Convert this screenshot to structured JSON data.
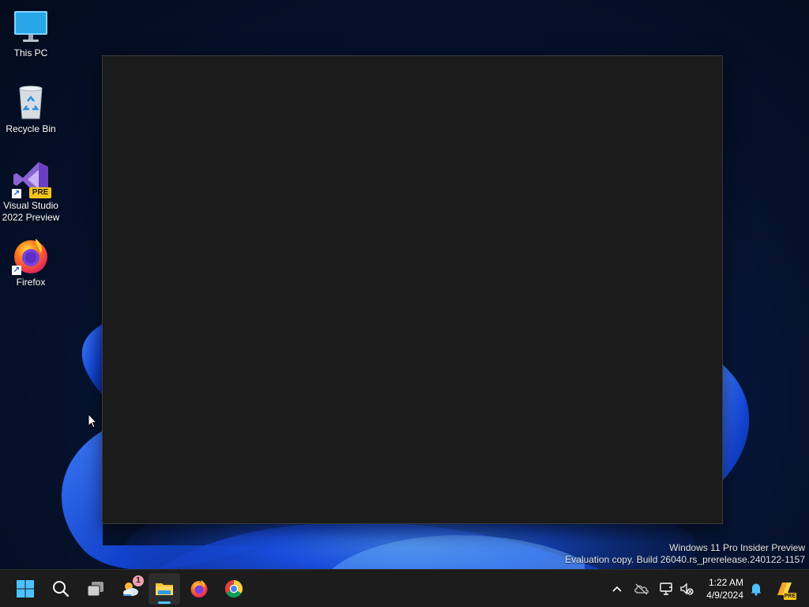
{
  "desktop": {
    "icons": [
      {
        "label": "This PC",
        "icon": "monitor-icon",
        "shortcut": false
      },
      {
        "label": "Recycle Bin",
        "icon": "recycle-bin-icon",
        "shortcut": false
      },
      {
        "label": "Visual Studio\n2022 Preview",
        "icon": "visual-studio-icon",
        "shortcut": true,
        "badge": "PRE"
      },
      {
        "label": "Firefox",
        "icon": "firefox-icon",
        "shortcut": true
      }
    ],
    "watermark": {
      "line1": "Windows 11 Pro Insider Preview",
      "line2": "Evaluation copy. Build 26040.rs_prerelease.240122-1157"
    }
  },
  "taskbar": {
    "buttons": [
      {
        "name": "start-button",
        "icon": "windows-logo-icon"
      },
      {
        "name": "search-button",
        "icon": "search-icon"
      },
      {
        "name": "task-view-button",
        "icon": "task-view-icon"
      },
      {
        "name": "widgets-button",
        "icon": "weather-icon",
        "badge": "1"
      },
      {
        "name": "file-explorer-button",
        "icon": "folder-icon",
        "active": true
      },
      {
        "name": "firefox-button",
        "icon": "firefox-icon"
      },
      {
        "name": "chrome-button",
        "icon": "chrome-icon"
      }
    ],
    "tray": {
      "icons": [
        "chevron-up-icon",
        "onedrive-icon",
        "network-icon",
        "volume-muted-icon",
        "notification-bell-icon",
        "copilot-icon"
      ],
      "time": "1:22 AM",
      "date": "4/9/2024",
      "copilot_badge": "PRE"
    }
  },
  "colors": {
    "accent": "#4cc2ff",
    "taskbar_bg": "#1c1c1c",
    "window_bg": "#1b1b1b"
  }
}
